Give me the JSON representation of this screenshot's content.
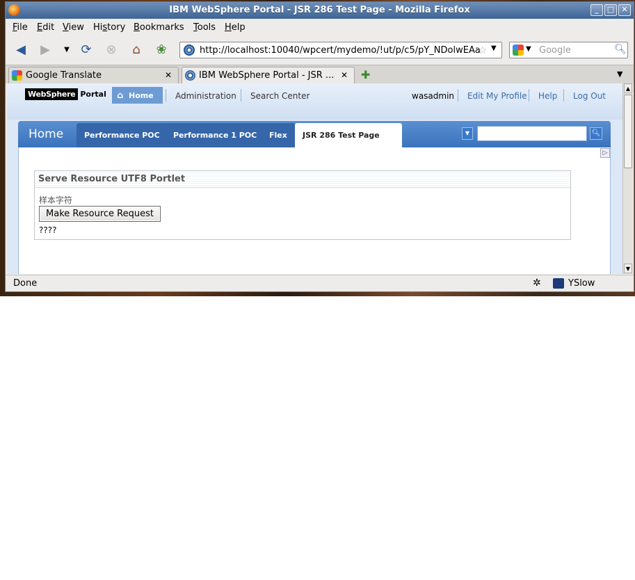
{
  "window": {
    "title": "IBM WebSphere Portal - JSR 286 Test Page - Mozilla Firefox",
    "controls": {
      "minimize": "_",
      "maximize": "□",
      "close": "✕"
    }
  },
  "menu": [
    {
      "label": "File",
      "u": "F",
      "rest": "ile"
    },
    {
      "label": "Edit",
      "u": "E",
      "rest": "dit"
    },
    {
      "label": "View",
      "u": "V",
      "rest": "iew"
    },
    {
      "label": "History",
      "u": "s",
      "pre": "Hi",
      "rest": "tory"
    },
    {
      "label": "Bookmarks",
      "u": "B",
      "rest": "ookmarks"
    },
    {
      "label": "Tools",
      "u": "T",
      "rest": "ools"
    },
    {
      "label": "Help",
      "u": "H",
      "rest": "elp"
    }
  ],
  "nav": {
    "url": "http://localhost:10040/wpcert/mydemo/!ut/p/c5/pY_NDolwEAa",
    "search_placeholder": "Google"
  },
  "tabs": [
    {
      "label": "Google Translate",
      "active": false
    },
    {
      "label": "IBM WebSphere Portal - JSR ...",
      "active": true
    }
  ],
  "portal": {
    "logo_ws": "WebSphere",
    "logo_portal": "Portal",
    "home_button": "Home",
    "top_links": [
      "Administration",
      "Search Center"
    ],
    "user": "wasadmin",
    "right_links": [
      "Edit My Profile",
      "Help",
      "Log Out"
    ],
    "page_title": "Home",
    "page_tabs": [
      {
        "label": "Performance POC",
        "selected": false
      },
      {
        "label": "Performance 1 POC",
        "selected": false
      },
      {
        "label": "Flex",
        "selected": false
      },
      {
        "label": "JSR 286 Test Page",
        "selected": true
      }
    ]
  },
  "portlet": {
    "title": "Serve Resource UTF8 Portlet",
    "sample_text": "样本字符",
    "button_label": "Make Resource Request",
    "result": "????"
  },
  "status": {
    "text": "Done",
    "yslow": "YSlow"
  }
}
